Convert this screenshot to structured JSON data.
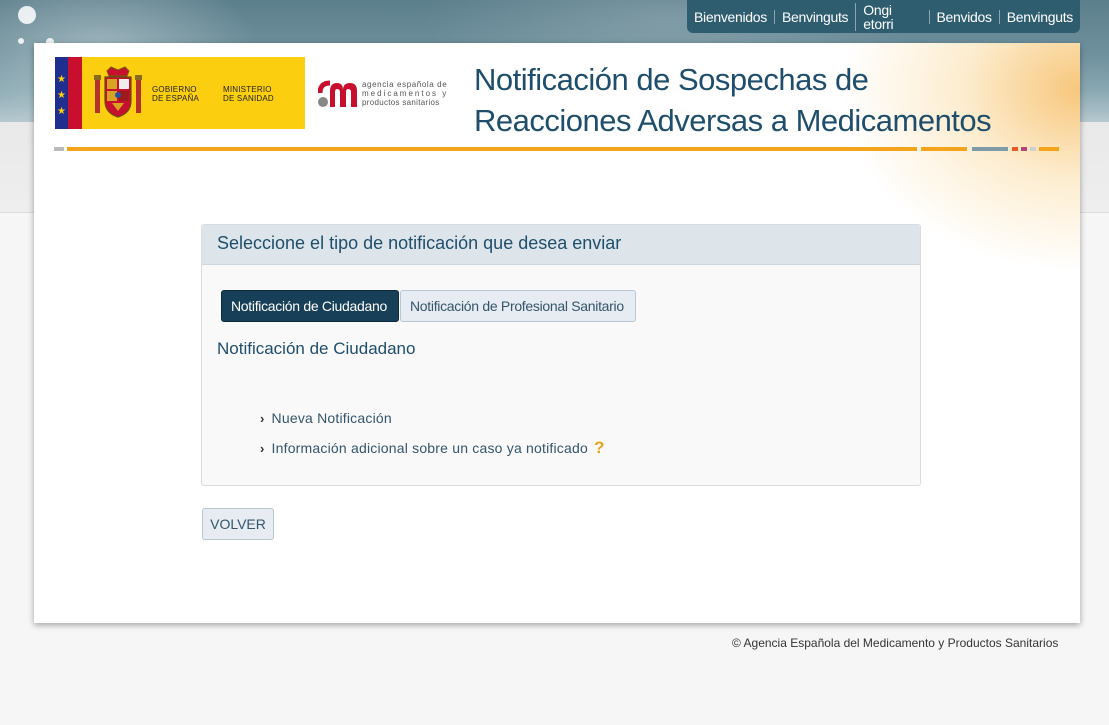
{
  "languages": [
    "Bienvenidos",
    "Benvinguts",
    "Ongi etorri",
    "Benvidos",
    "Benvinguts"
  ],
  "header": {
    "gov_logo": {
      "line1": "GOBIERNO",
      "line2": "DE ESPAÑA",
      "line3": "MINISTERIO",
      "line4": "DE SANIDAD"
    },
    "aemps_logo": {
      "line1": "agencia española de",
      "line2": "medicamentos y",
      "line3": "productos sanitarios"
    },
    "title_line1": "Notificación de Sospechas de",
    "title_line2": "Reacciones Adversas a Medicamentos"
  },
  "panel": {
    "heading": "Seleccione el tipo de notificación que desea enviar",
    "tabs": [
      {
        "label": "Notificación de Ciudadano",
        "active": true
      },
      {
        "label": "Notificación de Profesional Sanitario",
        "active": false
      }
    ],
    "section_title": "Notificación de Ciudadano",
    "links": [
      {
        "label": "Nueva Notificación"
      },
      {
        "label": "Información adicional sobre un caso ya notificado"
      }
    ]
  },
  "back_button": "VOLVER",
  "footer": "© Agencia Española del Medicamento y Productos Sanitarios",
  "colors": {
    "brand_blue": "#1f4e6c",
    "active_tab": "#173f57",
    "accent_orange": "#f4a31c",
    "lang_bar": "#2f5d70"
  },
  "icons": [
    "chevron-right-icon",
    "help-question-icon",
    "spain-coat-of-arms-icon",
    "aemps-logo-icon"
  ]
}
